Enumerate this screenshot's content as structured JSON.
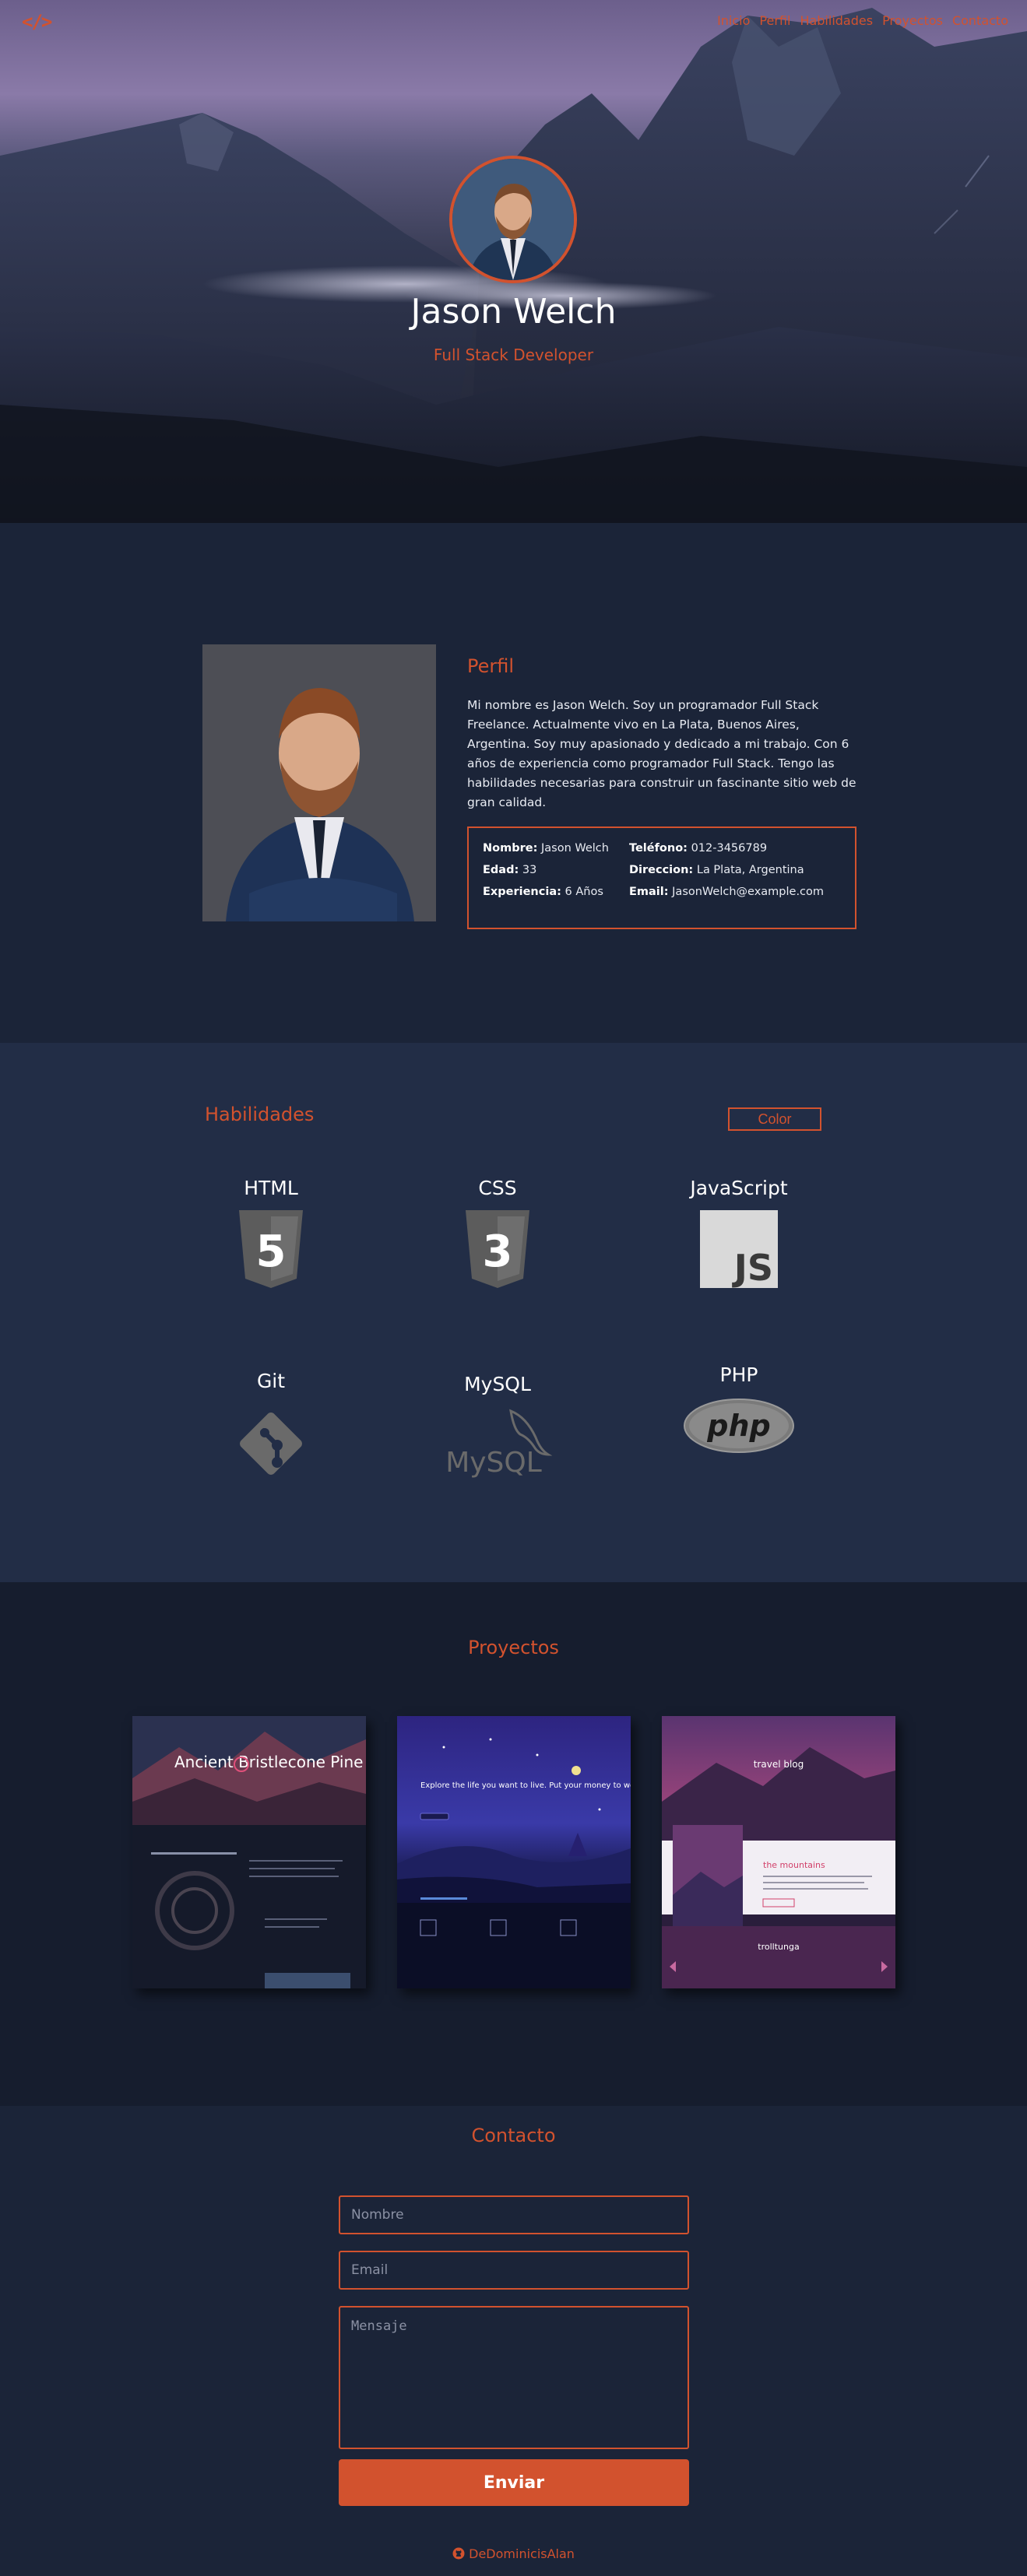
{
  "colors": {
    "accent": "#d2522e",
    "bg": "#1b2438",
    "bg_alt": "#222d46",
    "bg_dark": "#161d2e"
  },
  "nav": {
    "logo": "</>",
    "links": [
      "Inicio",
      "Perfil",
      "Habilidades",
      "Proyectos",
      "Contacto"
    ]
  },
  "hero": {
    "name": "Jason Welch",
    "role": "Full Stack Developer"
  },
  "perfil": {
    "title": "Perfil",
    "bio": "Mi nombre es Jason Welch. Soy un programador Full Stack Freelance. Actualmente vivo en La Plata, Buenos Aires, Argentina. Soy muy apasionado y dedicado a mi trabajo. Con 6 años de experiencia como programador Full Stack. Tengo las habilidades necesarias para construir un fascinante sitio web de gran calidad.",
    "info": [
      {
        "label": "Nombre:",
        "value": "Jason Welch"
      },
      {
        "label": "Teléfono:",
        "value": "012-3456789"
      },
      {
        "label": "Edad:",
        "value": "33"
      },
      {
        "label": "Direccion:",
        "value": "La Plata, Argentina"
      },
      {
        "label": "Experiencia:",
        "value": "6 Años"
      },
      {
        "label": "Email:",
        "value": "JasonWelch@example.com"
      }
    ]
  },
  "skills": {
    "title": "Habilidades",
    "color_button": "Color",
    "items": [
      {
        "name": "HTML",
        "icon": "html5-icon"
      },
      {
        "name": "CSS",
        "icon": "css3-icon"
      },
      {
        "name": "JavaScript",
        "icon": "js-icon"
      },
      {
        "name": "Git",
        "icon": "git-icon"
      },
      {
        "name": "MySQL",
        "icon": "mysql-icon"
      },
      {
        "name": "PHP",
        "icon": "php-icon"
      }
    ],
    "icon_text": {
      "html": "5",
      "css": "3",
      "js": "JS",
      "mysql": "MySQL",
      "php": "php"
    }
  },
  "projects": {
    "title": "Proyectos",
    "cards": [
      {
        "heading": "Ancient Bristlecone Pine Forest"
      },
      {
        "heading": "Explore the life you want to live. Put your money to work"
      },
      {
        "heading": "travel blog",
        "sub": "the mountains",
        "footer": "trolltunga"
      }
    ]
  },
  "contact": {
    "title": "Contacto",
    "name_placeholder": "Nombre",
    "email_placeholder": "Email",
    "message_placeholder": "Mensaje",
    "send_label": "Enviar"
  },
  "footer": {
    "github_label": "DeDominicisAlan"
  }
}
